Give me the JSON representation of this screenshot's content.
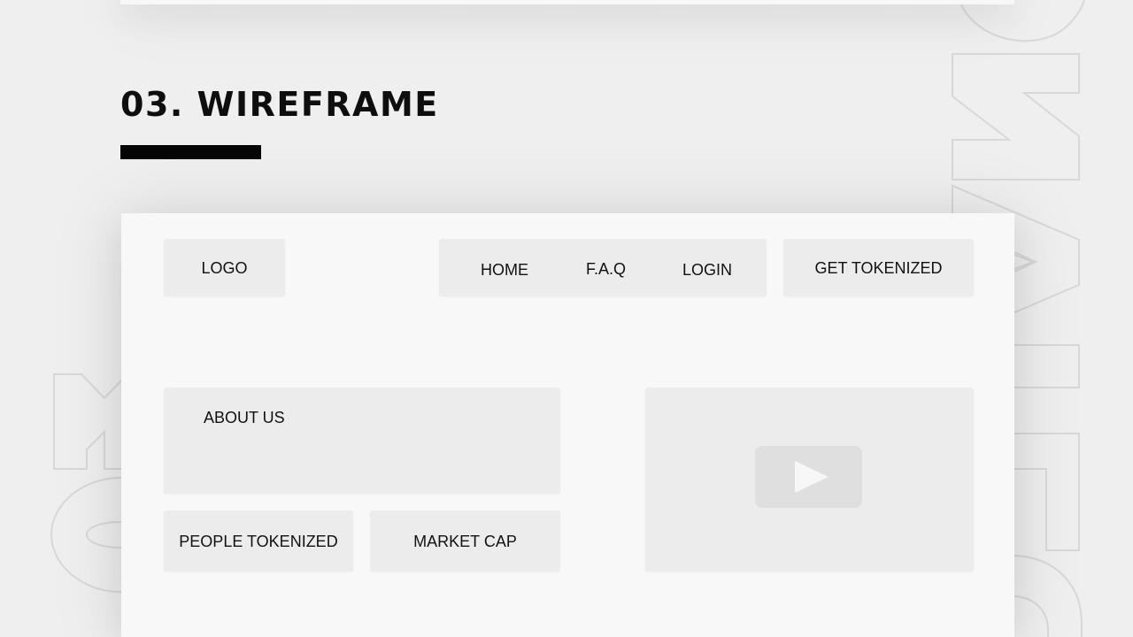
{
  "section": {
    "title": "03. WIREFRAME"
  },
  "background": {
    "outline_letters": [
      "O",
      "N",
      "A",
      "I",
      "F",
      "O",
      "M",
      "O"
    ]
  },
  "wireframe": {
    "header": {
      "logo_label": "LOGO",
      "nav_items": [
        {
          "label": "HOME"
        },
        {
          "label": "F.A.Q"
        },
        {
          "label": "LOGIN"
        }
      ],
      "cta_label": "GET TOKENIZED"
    },
    "content": {
      "about_label": "ABOUT US",
      "people_label": "PEOPLE TOKENIZED",
      "market_label": "MARKET CAP",
      "video_icon": "play-icon"
    }
  },
  "colors": {
    "background": "#efefef",
    "card": "#f8f8f8",
    "box": "#ececec",
    "title": "#0e0e0e",
    "title_bar": "#050505",
    "play_button": "#dfdfdf"
  }
}
